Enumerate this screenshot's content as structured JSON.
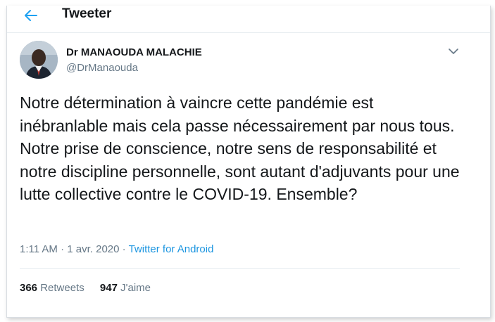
{
  "header": {
    "title": "Tweeter",
    "back_icon": "arrow-left-icon"
  },
  "tweet": {
    "author_name": "Dr MANAOUDA MALACHIE",
    "author_handle": "@DrManaouda",
    "text": "Notre détermination à vaincre cette pandémie est inébranlable mais cela passe nécessairement par nous tous. Notre prise de conscience, notre sens de responsabilité et notre discipline personnelle, sont autant d'adjuvants pour une lutte collective contre le COVID-19. Ensemble?",
    "time": "1:11 AM",
    "separator": " · ",
    "date": "1 avr. 2020",
    "source": "Twitter for Android"
  },
  "stats": {
    "retweets_count": "366",
    "retweets_label": "Retweets",
    "likes_count": "947",
    "likes_label": "J'aime"
  },
  "colors": {
    "accent": "#1b95e0",
    "secondary_text": "#657786",
    "primary_text": "#14171a"
  }
}
